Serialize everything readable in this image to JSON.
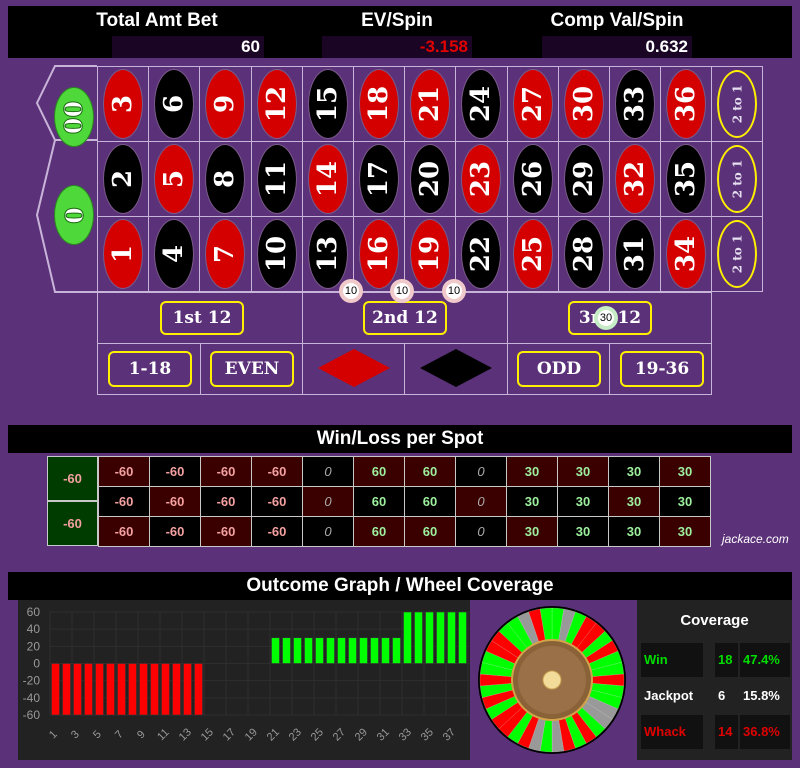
{
  "header": {
    "stats": [
      {
        "label": "Total Amt Bet",
        "value": "60",
        "negative": false
      },
      {
        "label": "EV/Spin",
        "value": "-3.158",
        "negative": true
      },
      {
        "label": "Comp Val/Spin",
        "value": "0.632",
        "negative": false
      }
    ]
  },
  "table": {
    "zeros": [
      "00",
      "0"
    ],
    "rows": [
      [
        {
          "n": "3",
          "c": "red"
        },
        {
          "n": "6",
          "c": "black"
        },
        {
          "n": "9",
          "c": "red"
        },
        {
          "n": "12",
          "c": "red"
        },
        {
          "n": "15",
          "c": "black"
        },
        {
          "n": "18",
          "c": "red"
        },
        {
          "n": "21",
          "c": "red"
        },
        {
          "n": "24",
          "c": "black"
        },
        {
          "n": "27",
          "c": "red"
        },
        {
          "n": "30",
          "c": "red"
        },
        {
          "n": "33",
          "c": "black"
        },
        {
          "n": "36",
          "c": "red"
        }
      ],
      [
        {
          "n": "2",
          "c": "black"
        },
        {
          "n": "5",
          "c": "red"
        },
        {
          "n": "8",
          "c": "black"
        },
        {
          "n": "11",
          "c": "black"
        },
        {
          "n": "14",
          "c": "red"
        },
        {
          "n": "17",
          "c": "black"
        },
        {
          "n": "20",
          "c": "black"
        },
        {
          "n": "23",
          "c": "red"
        },
        {
          "n": "26",
          "c": "black"
        },
        {
          "n": "29",
          "c": "black"
        },
        {
          "n": "32",
          "c": "red"
        },
        {
          "n": "35",
          "c": "black"
        }
      ],
      [
        {
          "n": "1",
          "c": "red"
        },
        {
          "n": "4",
          "c": "black"
        },
        {
          "n": "7",
          "c": "red"
        },
        {
          "n": "10",
          "c": "black"
        },
        {
          "n": "13",
          "c": "black"
        },
        {
          "n": "16",
          "c": "red"
        },
        {
          "n": "19",
          "c": "red"
        },
        {
          "n": "22",
          "c": "black"
        },
        {
          "n": "25",
          "c": "red"
        },
        {
          "n": "28",
          "c": "black"
        },
        {
          "n": "31",
          "c": "black"
        },
        {
          "n": "34",
          "c": "red"
        }
      ]
    ],
    "column_bets": [
      "2 to 1",
      "2 to 1",
      "2 to 1"
    ],
    "dozens": [
      "1st 12",
      "2nd 12",
      "3rd 12"
    ],
    "outside": [
      "1-18",
      "EVEN",
      "red-diamond",
      "black-diamond",
      "ODD",
      "19-36"
    ],
    "colors": {
      "red": "#d40000",
      "black": "#000000",
      "green": "#4fd83a",
      "felt": "#5b3279",
      "highlight": "#ffef00"
    },
    "chips": [
      {
        "bet": "six line 13-18",
        "amount": "10"
      },
      {
        "bet": "six line 16-21",
        "amount": "10"
      },
      {
        "bet": "six line 19-24",
        "amount": "10"
      },
      {
        "bet": "3rd 12",
        "amount": "30"
      }
    ]
  },
  "winloss": {
    "title": "Win/Loss per Spot",
    "zeros": [
      "-60",
      "-60"
    ],
    "rows": [
      [
        "-60",
        "-60",
        "-60",
        "-60",
        "0",
        "60",
        "60",
        "0",
        "30",
        "30",
        "30",
        "30"
      ],
      [
        "-60",
        "-60",
        "-60",
        "-60",
        "0",
        "60",
        "60",
        "0",
        "30",
        "30",
        "30",
        "30"
      ],
      [
        "-60",
        "-60",
        "-60",
        "-60",
        "0",
        "60",
        "60",
        "0",
        "30",
        "30",
        "30",
        "30"
      ]
    ],
    "credit": "jackace.com"
  },
  "outcome": {
    "title": "Outcome Graph / Wheel Coverage"
  },
  "chart_data": {
    "type": "bar",
    "title": "",
    "xlabel": "",
    "ylabel": "",
    "ylim": [
      -60,
      60
    ],
    "yticks": [
      60,
      40,
      20,
      0,
      -20,
      -40,
      -60
    ],
    "xtick_labels": [
      "1",
      "3",
      "5",
      "7",
      "9",
      "11",
      "13",
      "15",
      "17",
      "19",
      "21",
      "23",
      "25",
      "27",
      "29",
      "31",
      "33",
      "35",
      "37"
    ],
    "categories": [
      "1",
      "2",
      "3",
      "4",
      "5",
      "6",
      "7",
      "8",
      "9",
      "10",
      "11",
      "12",
      "13",
      "14",
      "15",
      "16",
      "17",
      "18",
      "19",
      "20",
      "21",
      "22",
      "23",
      "24",
      "25",
      "26",
      "27",
      "28",
      "29",
      "30",
      "31",
      "32",
      "33",
      "34",
      "35",
      "36",
      "37",
      "38"
    ],
    "values": [
      -60,
      -60,
      -60,
      -60,
      -60,
      -60,
      -60,
      -60,
      -60,
      -60,
      -60,
      -60,
      -60,
      -60,
      0,
      0,
      0,
      0,
      0,
      0,
      30,
      30,
      30,
      30,
      30,
      30,
      30,
      30,
      30,
      30,
      30,
      30,
      60,
      60,
      60,
      60,
      60,
      60
    ],
    "grid": true,
    "colors": {
      "positive": "#00ff00",
      "negative": "#ff0000"
    }
  },
  "coverage": {
    "title": "Coverage",
    "rows": [
      {
        "label": "Win",
        "count": "18",
        "pct": "47.4%",
        "color": "#00dd00"
      },
      {
        "label": "Jackpot",
        "count": "6",
        "pct": "15.8%",
        "color": "#ffffff"
      },
      {
        "label": "Whack",
        "count": "14",
        "pct": "36.8%",
        "color": "#e00000"
      }
    ],
    "wheel_sequence": [
      "green",
      "gray",
      "green",
      "red",
      "red",
      "green",
      "red",
      "green",
      "green",
      "red",
      "green",
      "green",
      "gray",
      "gray",
      "green",
      "red",
      "green",
      "red",
      "gray",
      "green",
      "gray",
      "red",
      "green",
      "red",
      "red",
      "green",
      "red",
      "green",
      "red",
      "green",
      "green",
      "red",
      "red",
      "green",
      "green",
      "gray",
      "red",
      "green"
    ],
    "wheel_colors": {
      "green": "#00ff00",
      "red": "#ff0000",
      "gray": "#999999"
    }
  }
}
